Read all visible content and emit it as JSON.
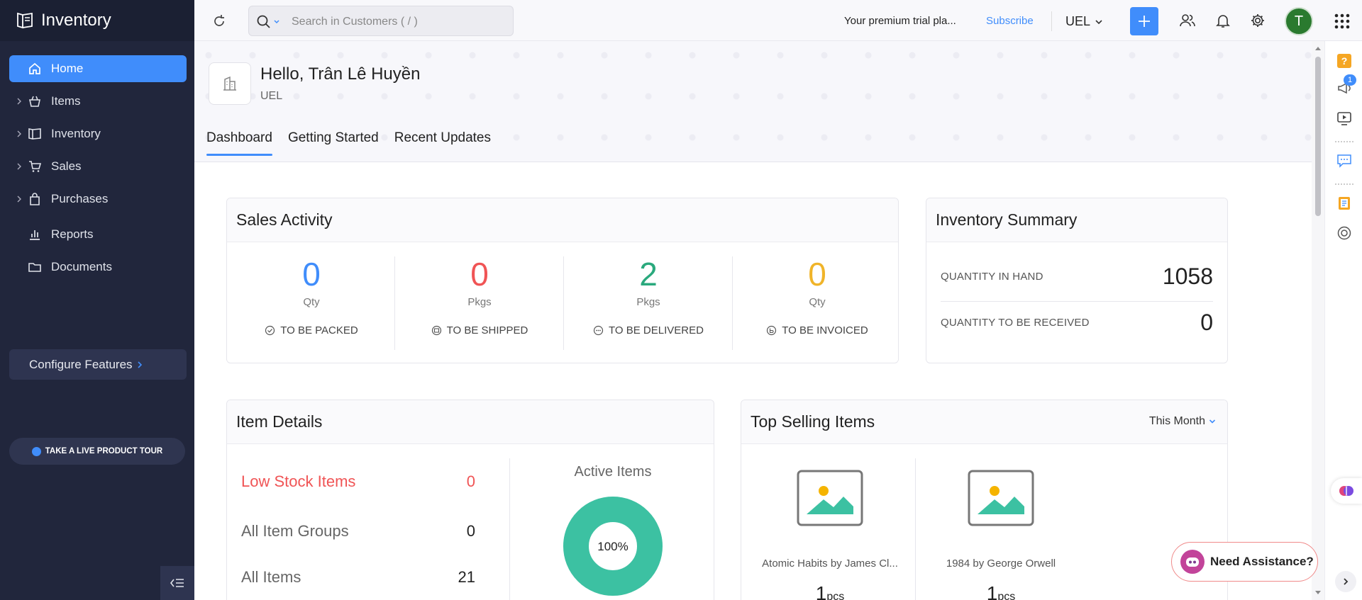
{
  "sidebar": {
    "brand": "Inventory",
    "items": [
      {
        "label": "Home"
      },
      {
        "label": "Items"
      },
      {
        "label": "Inventory"
      },
      {
        "label": "Sales"
      },
      {
        "label": "Purchases"
      },
      {
        "label": "Reports"
      },
      {
        "label": "Documents"
      }
    ],
    "configure_label": "Configure Features",
    "tour_label": "TAKE A LIVE PRODUCT TOUR"
  },
  "topbar": {
    "search_placeholder": "Search in Customers ( / )",
    "trial_text": "Your premium trial pla...",
    "subscribe_label": "Subscribe",
    "org_label": "UEL",
    "avatar_initial": "T"
  },
  "header": {
    "greeting": "Hello, Trân Lê Huyền",
    "org_name": "UEL",
    "tabs": [
      "Dashboard",
      "Getting Started",
      "Recent Updates"
    ]
  },
  "sales_activity": {
    "title": "Sales Activity",
    "items": [
      {
        "value": "0",
        "unit": "Qty",
        "label": "TO BE PACKED",
        "color": "#408dfb"
      },
      {
        "value": "0",
        "unit": "Pkgs",
        "label": "TO BE SHIPPED",
        "color": "#f05455"
      },
      {
        "value": "2",
        "unit": "Pkgs",
        "label": "TO BE DELIVERED",
        "color": "#2aa97d"
      },
      {
        "value": "0",
        "unit": "Qty",
        "label": "TO BE INVOICED",
        "color": "#f0b429"
      }
    ]
  },
  "inventory_summary": {
    "title": "Inventory Summary",
    "rows": [
      {
        "label": "QUANTITY IN HAND",
        "value": "1058"
      },
      {
        "label": "QUANTITY TO BE RECEIVED",
        "value": "0"
      }
    ]
  },
  "item_details": {
    "title": "Item Details",
    "rows": [
      {
        "label": "Low Stock Items",
        "value": "0"
      },
      {
        "label": "All Item Groups",
        "value": "0"
      },
      {
        "label": "All Items",
        "value": "21"
      }
    ],
    "active_items_label": "Active Items",
    "active_items_percent": "100%",
    "active_items_fraction": 1.0,
    "donut_color": "#3cc1a2"
  },
  "top_selling": {
    "title": "Top Selling Items",
    "period": "This Month",
    "items": [
      {
        "name": "Atomic Habits by James Cl...",
        "qty": "1",
        "unit": "pcs"
      },
      {
        "name": "1984 by George Orwell",
        "qty": "1",
        "unit": "pcs"
      }
    ]
  },
  "assist_label": "Need Assistance?",
  "rail_badge": "1",
  "colors": {
    "accent": "#408dfb",
    "sidebar": "#21263c",
    "low_stock": "#f05455"
  }
}
